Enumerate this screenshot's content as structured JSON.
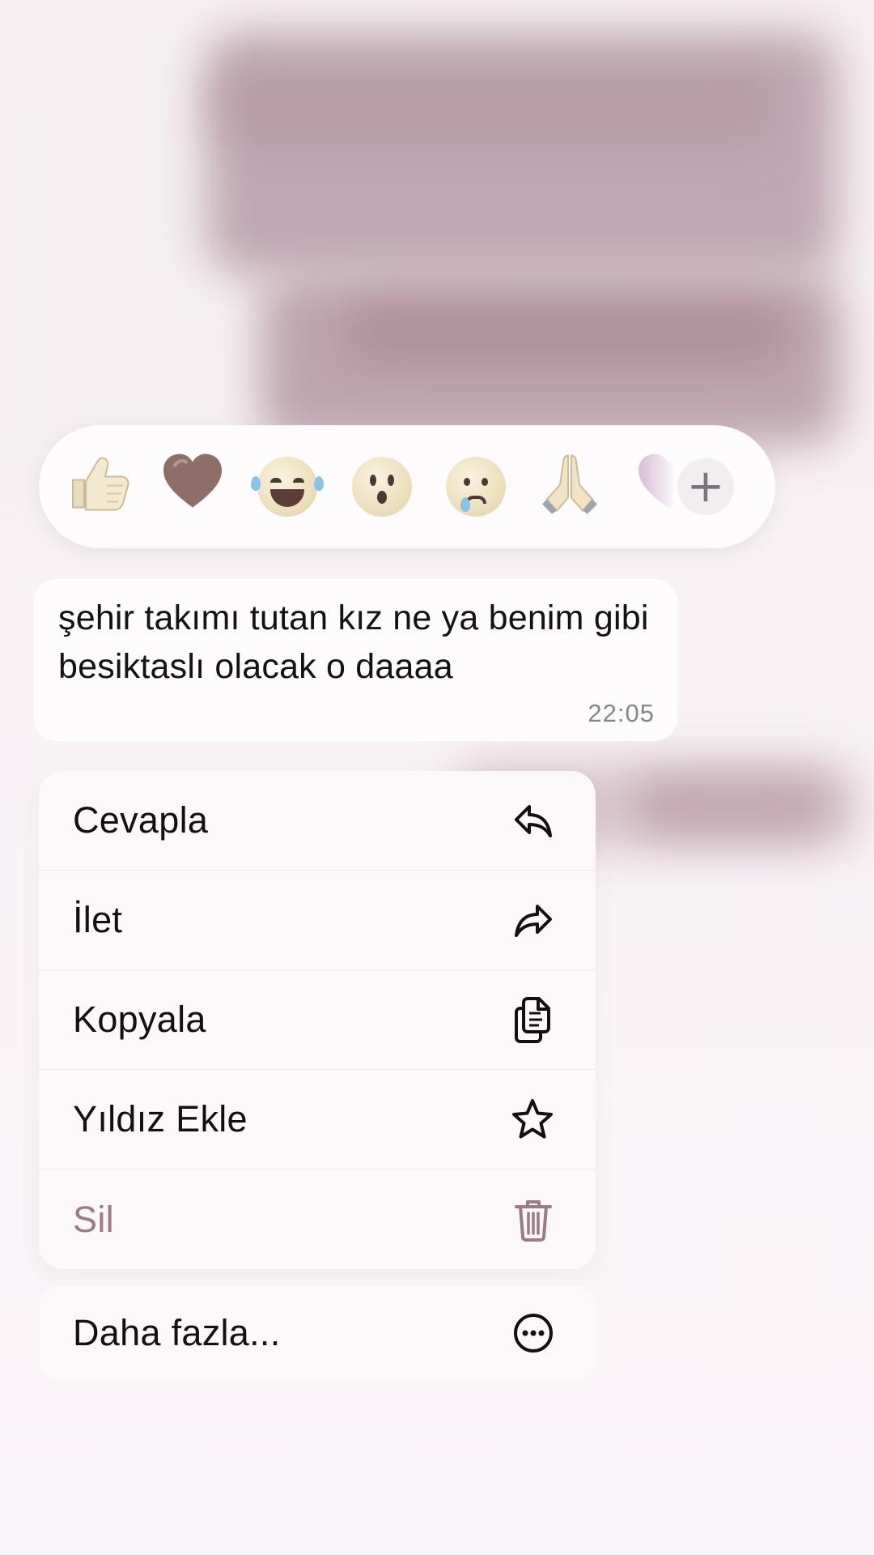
{
  "reactions": {
    "emojis": [
      {
        "name": "thumbs-up",
        "glyph": "👍"
      },
      {
        "name": "heart",
        "glyph": "♥"
      },
      {
        "name": "laughing-face",
        "glyph": "😂"
      },
      {
        "name": "surprised-face",
        "glyph": "😮"
      },
      {
        "name": "crying-face",
        "glyph": "😢"
      },
      {
        "name": "praying-hands",
        "glyph": "🙏"
      }
    ],
    "more_label": "+"
  },
  "message": {
    "text": "şehir takımı tutan kız ne ya benim gibi besiktaslı olacak o daaaa",
    "time": "22:05"
  },
  "menu": {
    "items": [
      {
        "label": "Cevapla",
        "icon": "reply-icon"
      },
      {
        "label": "İlet",
        "icon": "forward-icon"
      },
      {
        "label": "Kopyala",
        "icon": "copy-icon"
      },
      {
        "label": "Yıldız Ekle",
        "icon": "star-icon"
      },
      {
        "label": "Sil",
        "icon": "trash-icon",
        "color": "#9b7b88"
      }
    ],
    "more": {
      "label": "Daha fazla...",
      "icon": "more-icon"
    }
  },
  "colors": {
    "danger": "#9b7b88",
    "text": "#121012",
    "timestamp": "#8a8488"
  }
}
